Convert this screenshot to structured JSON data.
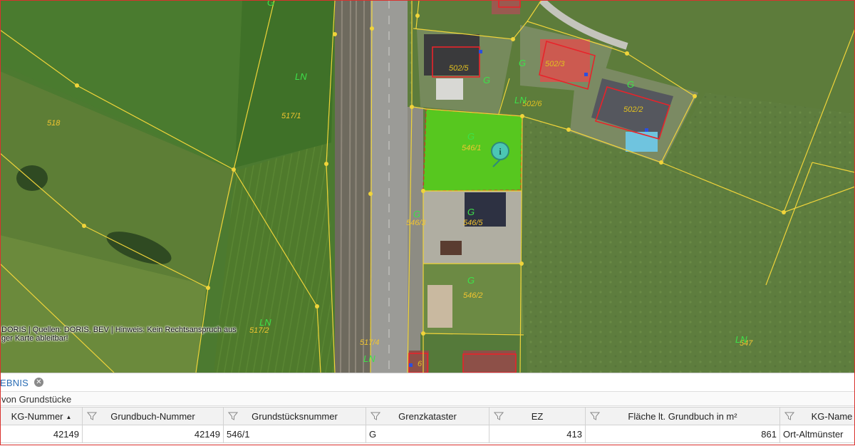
{
  "map": {
    "parcel_labels": [
      "518",
      "517/1",
      "517/2",
      "517/4",
      "502/5",
      "502/3",
      "502/6",
      "502/2",
      "546/1",
      "546/5",
      "546/2",
      "546/3",
      "547",
      "6"
    ],
    "use_labels": [
      "LN",
      "LN",
      "LN",
      "LN",
      "LN",
      "G",
      "G",
      "G",
      "G",
      "G",
      "G",
      "G",
      "G"
    ],
    "attribution_line1": "DORIS | Quellen: DORIS, BEV | Hinweis: Kein Rechtsanspruch aus",
    "attribution_line2": "ger Karte ableitbar!",
    "colors": {
      "parcel_line": "#f0d43a",
      "selected_fill": "#5ed42a",
      "building_outline": "#e8232a"
    }
  },
  "result_panel": {
    "tab_label": "EBNIS",
    "close_icon": "close-circle-icon",
    "subtitle": "von Grundstücke",
    "columns": [
      "KG-Nummer",
      "Grundbuch-Nummer",
      "Grundstücksnummer",
      "Grenzkataster",
      "EZ",
      "Fläche lt. Grundbuch in m²",
      "KG-Name"
    ],
    "sort_indicator": "▲",
    "rows": [
      {
        "kg_nummer": "42149",
        "grundbuch_nummer": "42149",
        "grundstuecksnummer": "546/1",
        "grenzkataster": "G",
        "ez": "413",
        "flaeche": "861",
        "kg_name": "Ort-Altmünster"
      }
    ]
  }
}
